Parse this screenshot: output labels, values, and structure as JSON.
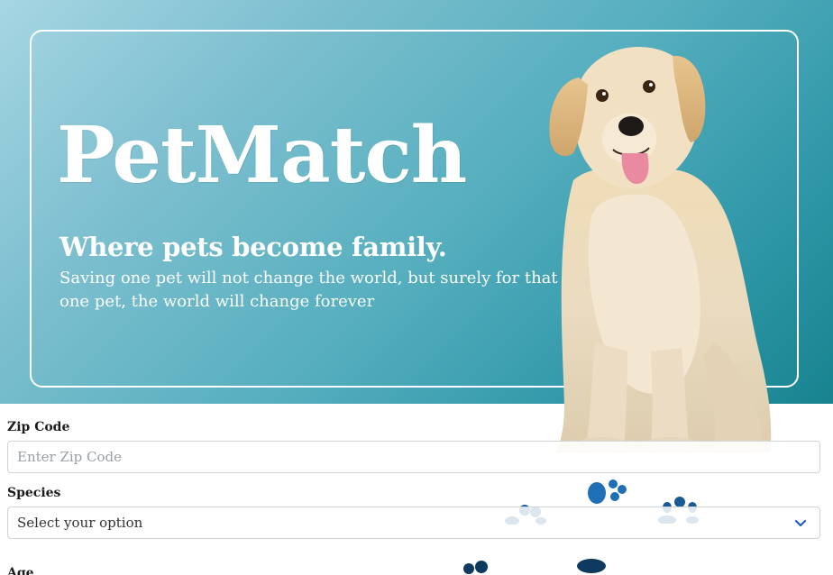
{
  "hero": {
    "title": "PetMatch",
    "tagline": "Where pets become family.",
    "quote": "Saving one pet will not change the world, but surely for that one pet, the world will change forever",
    "gradient_start": "#a6d6e3",
    "gradient_end": "#18838f"
  },
  "form": {
    "zip": {
      "label": "Zip Code",
      "placeholder": "Enter Zip Code",
      "value": ""
    },
    "species": {
      "label": "Species",
      "selected": "Select your option",
      "icon": "chevron-down-icon",
      "icon_color": "#1f5fbf"
    },
    "age": {
      "label": "Age"
    }
  },
  "decorations": {
    "dog_image": "golden-retriever-photo",
    "paw_icon": "paw-print-icon",
    "paw_colors": [
      "#1f6fb5",
      "#0d3a5e"
    ]
  }
}
